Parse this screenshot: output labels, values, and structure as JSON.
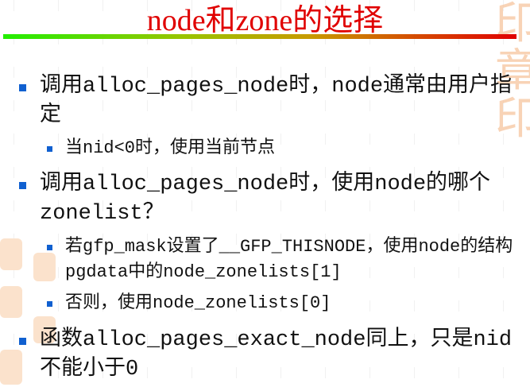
{
  "title": "node和zone的选择",
  "colors": {
    "title": "#e00000",
    "bullet": "#1060d0",
    "bar_start": "#22ee00",
    "bar_end": "#e00000"
  },
  "bullets": [
    {
      "text": "调用alloc_pages_node时，node通常由用户指定",
      "sub": [
        "当nid<0时，使用当前节点"
      ]
    },
    {
      "text": "调用alloc_pages_node时，使用node的哪个zonelist？",
      "sub": [
        "若gfp_mask设置了__GFP_THISNODE，使用node的结构pgdata中的node_zonelists[1]",
        "否则，使用node_zonelists[0]"
      ]
    },
    {
      "text": "函数alloc_pages_exact_node同上，只是nid不能小于0",
      "sub": []
    }
  ]
}
